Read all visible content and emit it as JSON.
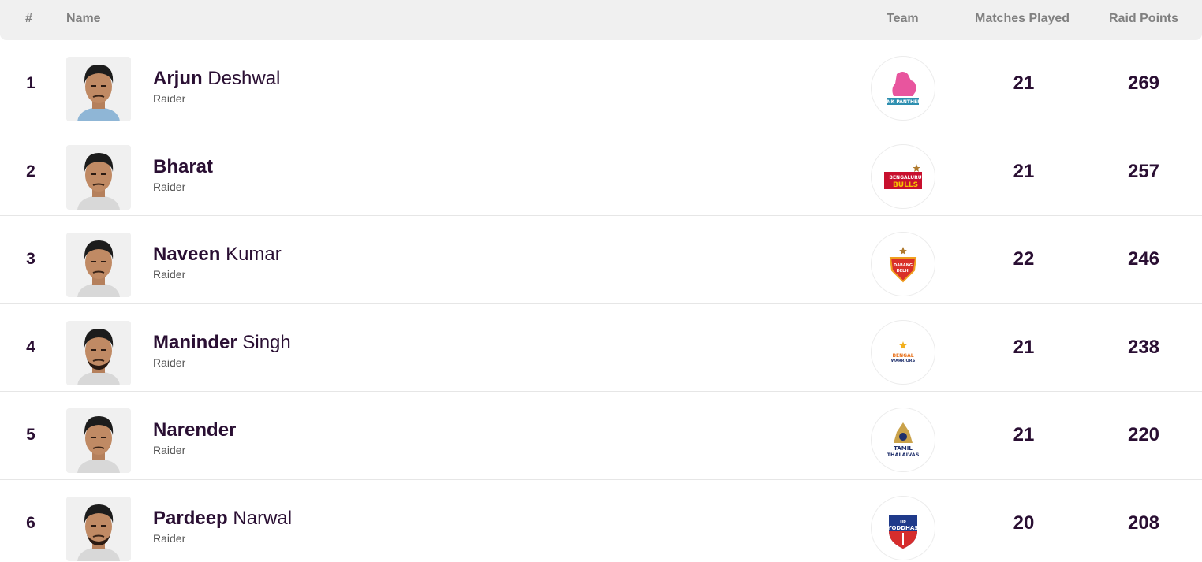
{
  "header": {
    "rank": "#",
    "name": "Name",
    "team": "Team",
    "matches": "Matches Played",
    "raid": "Raid Points"
  },
  "rows": [
    {
      "rank": "1",
      "first": "Arjun",
      "last": "Deshwal",
      "role": "Raider",
      "team": "Jaipur Pink Panthers",
      "team_icon": "pink-panther-logo",
      "matches": "21",
      "raid": "269",
      "team_color": "#e8559e"
    },
    {
      "rank": "2",
      "first": "Bharat",
      "last": "",
      "role": "Raider",
      "team": "Bengaluru Bulls",
      "team_icon": "bengaluru-bulls-logo",
      "matches": "21",
      "raid": "257",
      "team_color": "#c8102e"
    },
    {
      "rank": "3",
      "first": "Naveen",
      "last": "Kumar",
      "role": "Raider",
      "team": "Dabang Delhi K.C.",
      "team_icon": "dabang-delhi-logo",
      "matches": "22",
      "raid": "246",
      "team_color": "#d9302a"
    },
    {
      "rank": "4",
      "first": "Maninder",
      "last": "Singh",
      "role": "Raider",
      "team": "Bengal Warriors",
      "team_icon": "bengal-warriors-logo",
      "matches": "21",
      "raid": "238",
      "team_color": "#e8721c"
    },
    {
      "rank": "5",
      "first": "Narender",
      "last": "",
      "role": "Raider",
      "team": "Tamil Thalaivas",
      "team_icon": "tamil-thalaivas-logo",
      "matches": "21",
      "raid": "220",
      "team_color": "#1f2f6b"
    },
    {
      "rank": "6",
      "first": "Pardeep",
      "last": "Narwal",
      "role": "Raider",
      "team": "UP Yoddhas",
      "team_icon": "up-yoddhas-logo",
      "matches": "20",
      "raid": "208",
      "team_color": "#1f3a8a"
    }
  ]
}
